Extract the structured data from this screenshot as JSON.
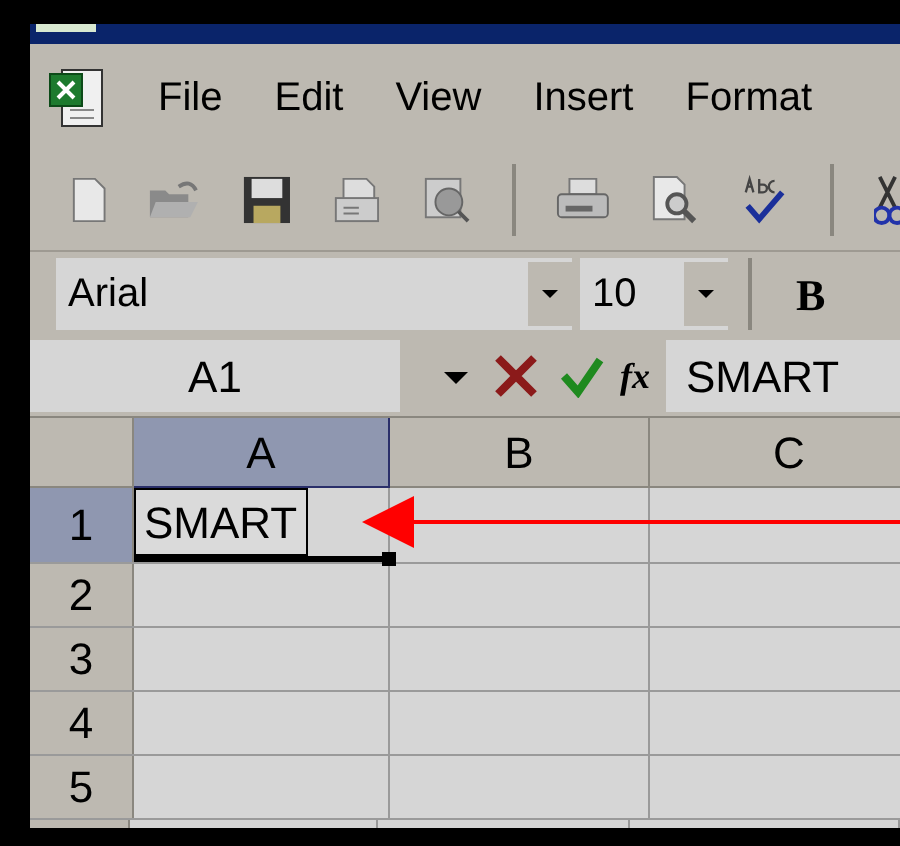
{
  "menu": [
    {
      "label": "File"
    },
    {
      "label": "Edit"
    },
    {
      "label": "View"
    },
    {
      "label": "Insert"
    },
    {
      "label": "Format"
    }
  ],
  "formatting": {
    "font": "Arial",
    "size": "10",
    "bold": "B"
  },
  "formula_bar": {
    "name_box": "A1",
    "function_symbol": "fx",
    "formula": "SMART"
  },
  "columns": [
    {
      "label": "A",
      "selected": true
    },
    {
      "label": "B",
      "selected": false
    },
    {
      "label": "C",
      "selected": false
    }
  ],
  "rows": [
    {
      "label": "1",
      "selected": true,
      "value": "SMART"
    },
    {
      "label": "2",
      "selected": false
    },
    {
      "label": "3",
      "selected": false
    },
    {
      "label": "4",
      "selected": false
    },
    {
      "label": "5",
      "selected": false
    }
  ]
}
